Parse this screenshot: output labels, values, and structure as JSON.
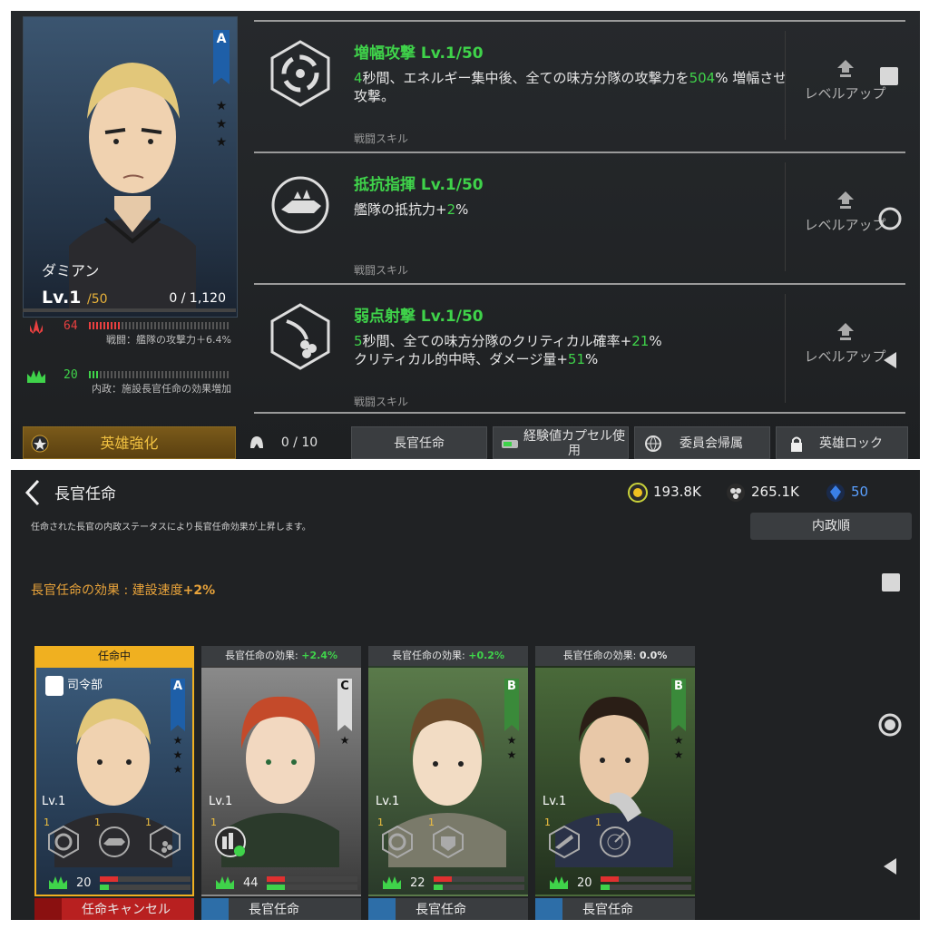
{
  "hero": {
    "name": "ダミアン",
    "level": "Lv.1",
    "level_max": "/50",
    "exp": "0 / 1,120",
    "rank": "A",
    "stars": [
      "★",
      "★",
      "★"
    ],
    "combat": {
      "value": "64",
      "desc": "戦闘：艦隊の攻撃力＋6.4%",
      "color": "#e84040"
    },
    "admin": {
      "value": "20",
      "desc": "内政：施設長官任命の効果増加",
      "color": "#3fd34a"
    }
  },
  "skills": [
    {
      "title": "増幅攻撃 Lv.1/50",
      "desc_parts": [
        {
          "t": "4",
          "g": true
        },
        {
          "t": "秒間、エネルギー集中後、全ての味方分隊の攻撃力を",
          "g": false
        },
        {
          "t": "504",
          "g": true
        },
        {
          "t": "% 増幅させ攻撃。",
          "g": false
        }
      ],
      "type": "戦闘スキル",
      "action": "レベルアップ",
      "icon": "vortex-icon"
    },
    {
      "title": "抵抗指揮 Lv.1/50",
      "desc_parts": [
        {
          "t": "艦隊の抵抗力+",
          "g": false
        },
        {
          "t": "2",
          "g": true
        },
        {
          "t": "%",
          "g": false
        }
      ],
      "type": "戦闘スキル",
      "action": "レベルアップ",
      "icon": "ship-icon"
    },
    {
      "title": "弱点射撃 Lv.1/50",
      "desc_parts": [
        {
          "t": "5",
          "g": true
        },
        {
          "t": "秒間、全ての味方分隊のクリティカル確率+",
          "g": false
        },
        {
          "t": "21",
          "g": true
        },
        {
          "t": "%\nクリティカル的中時、ダメージ量+",
          "g": false
        },
        {
          "t": "51",
          "g": true
        },
        {
          "t": "%",
          "g": false
        }
      ],
      "type": "戦闘スキル",
      "action": "レベルアップ",
      "icon": "missile-icon"
    }
  ],
  "tabs": {
    "enhance": "英雄強化",
    "count": "0 / 10",
    "appoint": "長官任命",
    "capsule": "経験値カプセル使用",
    "committee": "委員会帰属",
    "lock": "英雄ロック"
  },
  "appoint_screen": {
    "title": "長官任命",
    "resources": [
      "193.8K",
      "265.1K",
      "50"
    ],
    "note": "任命された長官の内政ステータスにより長官任命効果が上昇します。",
    "sort": "内政順",
    "effect_label": "長官任命の効果 : 建設速度",
    "effect_value": "+2%",
    "cards": [
      {
        "head": "任命中",
        "head_value": "",
        "rank": "A",
        "rank_color": "#1e5fa8",
        "stars": [
          "★",
          "★",
          "★"
        ],
        "hq": "司令部",
        "lv": "Lv.1",
        "skill_levels": [
          "1",
          "1",
          "1"
        ],
        "admin": "20",
        "foot": "任命キャンセル",
        "bg": "#2a4560"
      },
      {
        "head": "長官任命の効果: ",
        "head_value": "+2.4%",
        "rank": "C",
        "rank_color": "#777777",
        "stars": [
          "★"
        ],
        "hq": "",
        "lv": "Lv.1",
        "skill_levels": [
          "1"
        ],
        "admin": "44",
        "foot": "長官任命",
        "bg": "#6a6a6a"
      },
      {
        "head": "長官任命の効果: ",
        "head_value": "+0.2%",
        "rank": "B",
        "rank_color": "#3a8a3a",
        "stars": [
          "★",
          "★"
        ],
        "hq": "",
        "lv": "Lv.1",
        "skill_levels": [
          "1",
          "1"
        ],
        "admin": "22",
        "foot": "長官任命",
        "bg": "#3f5a3a"
      },
      {
        "head": "長官任命の効果: ",
        "head_value": "0.0%",
        "rank": "B",
        "rank_color": "#3a8a3a",
        "stars": [
          "★",
          "★"
        ],
        "hq": "",
        "lv": "Lv.1",
        "skill_levels": [
          "1",
          "1"
        ],
        "admin": "20",
        "foot": "長官任命",
        "bg": "#3f5a3a"
      }
    ]
  }
}
